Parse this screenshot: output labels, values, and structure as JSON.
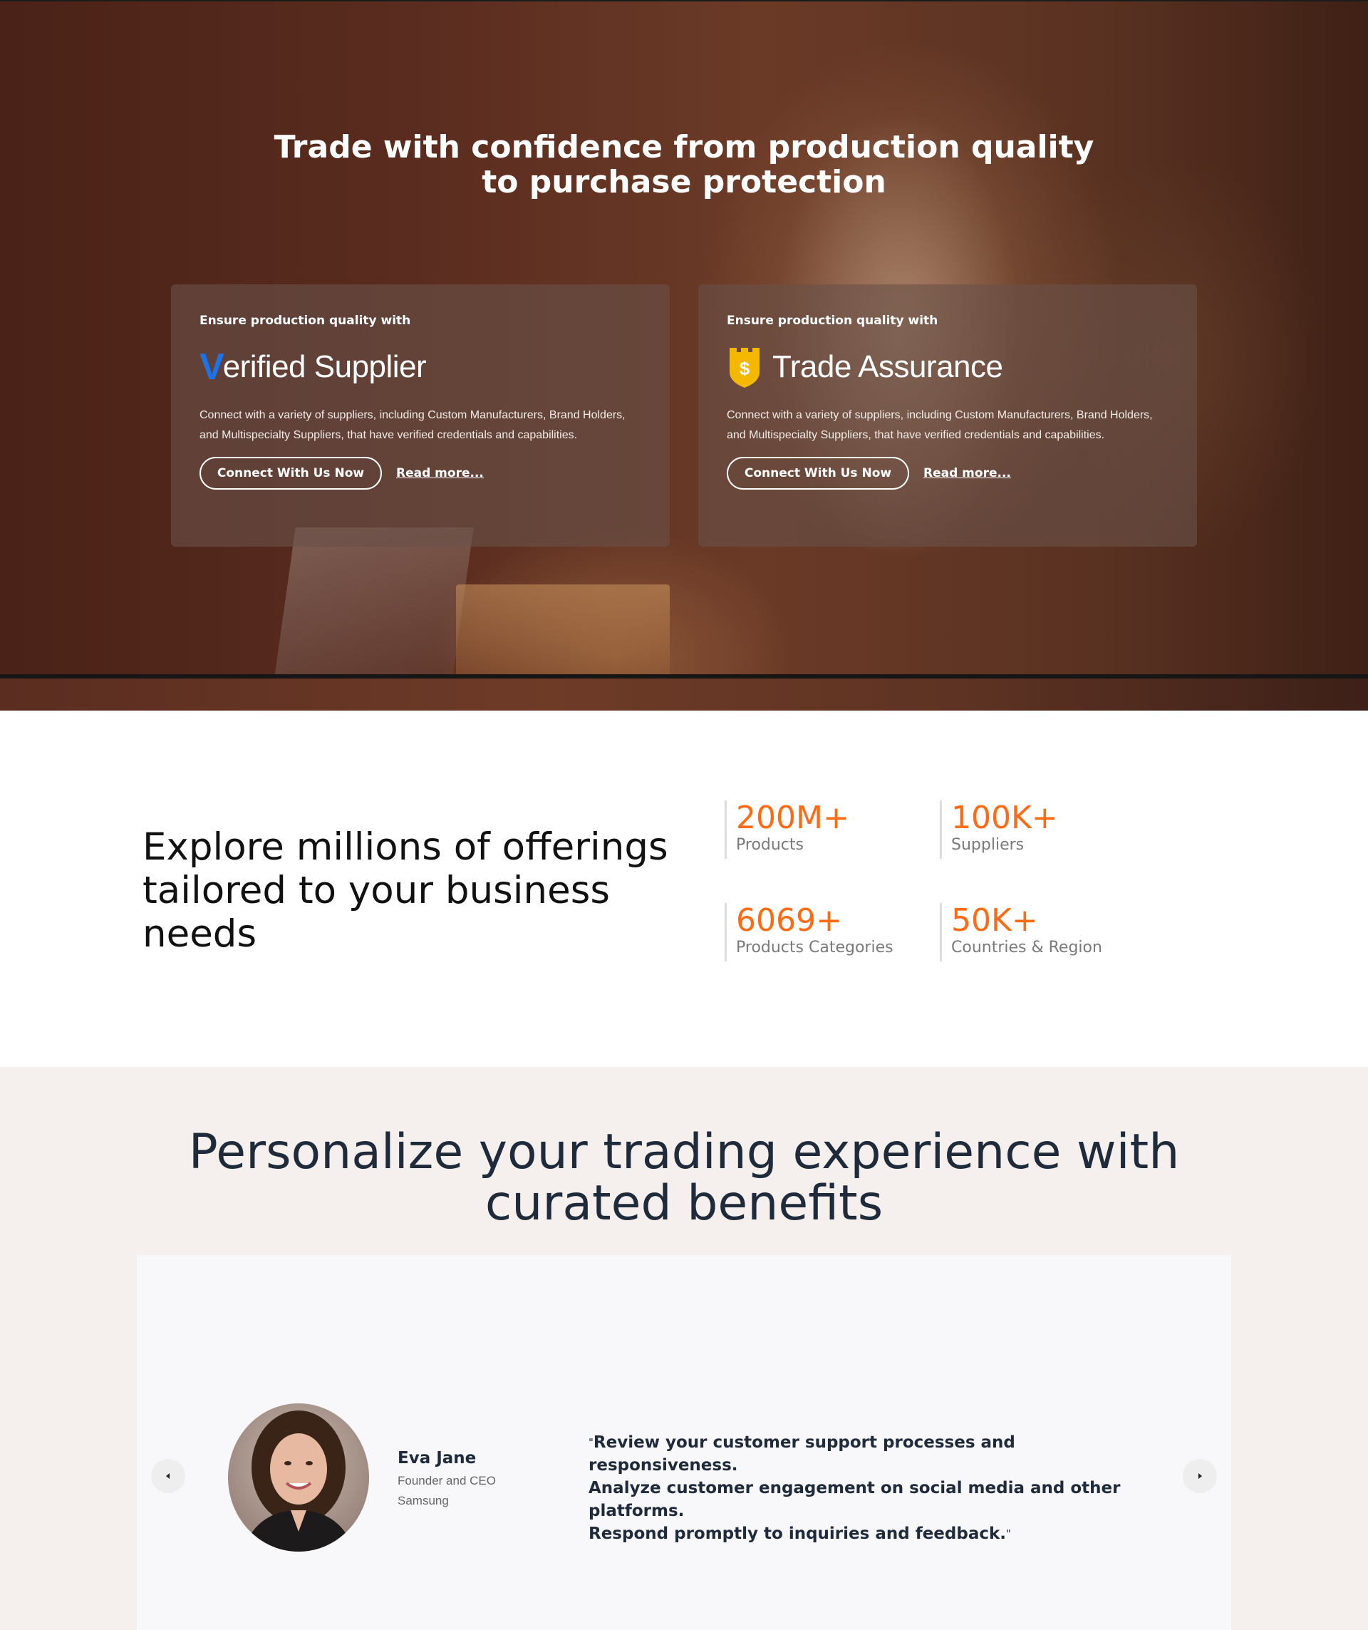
{
  "hero": {
    "title_line1": "Trade with confidence from production quality",
    "title_line2": "to purchase protection",
    "cards": [
      {
        "eyebrow": "Ensure production quality with",
        "logo_mark": "V",
        "logo_text": "erified Supplier",
        "description": "Connect with a variety of suppliers, including Custom Manufacturers, Brand Holders, and Multispecialty Suppliers, that have verified credentials and capabilities.",
        "cta_label": "Connect With Us Now",
        "link_label": "Read more..."
      },
      {
        "eyebrow": "Ensure production quality with",
        "logo_mark": "$",
        "logo_text": "Trade Assurance",
        "description": "Connect with a variety of suppliers, including Custom Manufacturers, Brand Holders, and Multispecialty Suppliers, that have verified credentials and capabilities.",
        "cta_label": "Connect With Us Now",
        "link_label": "Read more..."
      }
    ],
    "icons": {
      "verified": "checkmark-logo-icon",
      "assurance": "shield-dollar-icon"
    },
    "colors": {
      "verified_blue": "#1a73e8",
      "assurance_gold": "#f5b800"
    }
  },
  "stats": {
    "heading_line1": "Explore millions of offerings",
    "heading_line2": "tailored to your business",
    "heading_line3": "needs",
    "items": [
      {
        "value": "200M+",
        "label": "Products"
      },
      {
        "value": "100K+",
        "label": "Suppliers"
      },
      {
        "value": "6069+",
        "label": "Products Categories"
      },
      {
        "value": "50K+",
        "label": "Countries & Region"
      }
    ],
    "accent_color": "#ff6a12"
  },
  "benefits": {
    "title_line1": "Personalize your trading experience with",
    "title_line2": "curated benefits",
    "testimonial": {
      "name": "Eva Jane",
      "role": "Founder and CEO",
      "company": "Samsung",
      "quote_open": "\"",
      "quote_lines": [
        "Review your customer support processes and responsiveness.",
        "Analyze customer engagement on social media and other",
        "platforms.",
        "Respond promptly to inquiries and feedback."
      ],
      "quote_close": "\""
    },
    "nav": {
      "prev_icon": "caret-left-icon",
      "next_icon": "caret-right-icon"
    }
  }
}
